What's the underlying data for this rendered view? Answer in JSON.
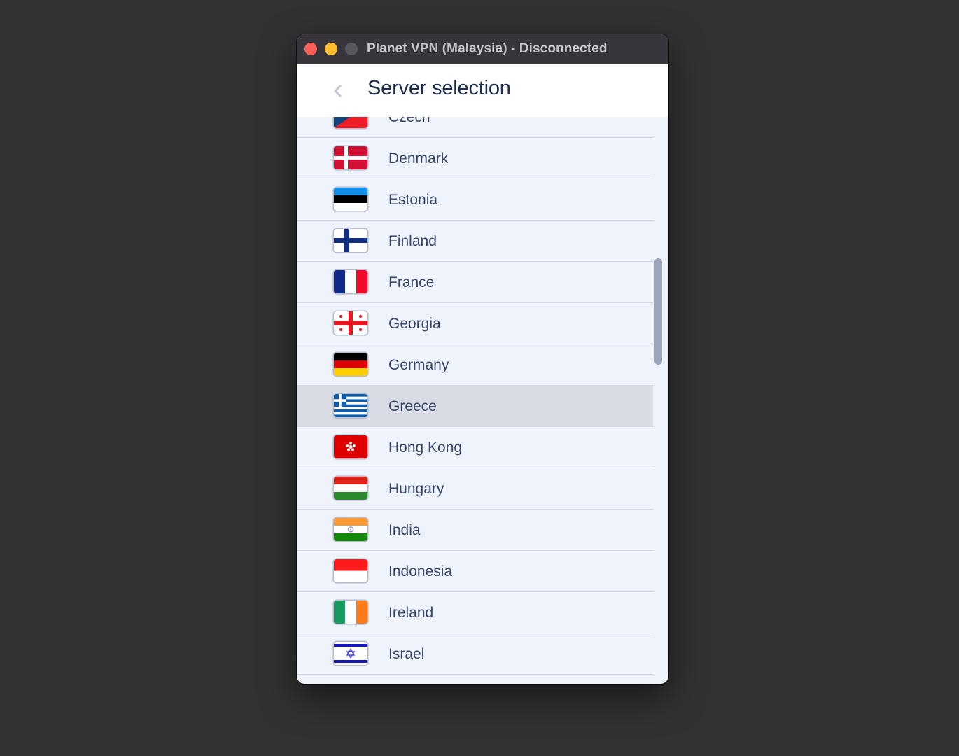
{
  "window": {
    "title": "Planet VPN (Malaysia) - Disconnected"
  },
  "header": {
    "back_icon": "chevron-left-icon",
    "title": "Server selection"
  },
  "servers": [
    {
      "country": "Czech",
      "flag": "cz"
    },
    {
      "country": "Denmark",
      "flag": "dk"
    },
    {
      "country": "Estonia",
      "flag": "ee"
    },
    {
      "country": "Finland",
      "flag": "fi"
    },
    {
      "country": "France",
      "flag": "fr"
    },
    {
      "country": "Georgia",
      "flag": "ge"
    },
    {
      "country": "Germany",
      "flag": "de"
    },
    {
      "country": "Greece",
      "flag": "gr",
      "selected": true
    },
    {
      "country": "Hong Kong",
      "flag": "hk"
    },
    {
      "country": "Hungary",
      "flag": "hu"
    },
    {
      "country": "India",
      "flag": "in"
    },
    {
      "country": "Indonesia",
      "flag": "id"
    },
    {
      "country": "Ireland",
      "flag": "ie"
    },
    {
      "country": "Israel",
      "flag": "il"
    }
  ],
  "colors": {
    "title_text": "#1d2f4f",
    "country_text": "#35476a",
    "list_bg": "#eff3fb",
    "selected_bg": "#d9dce4",
    "scrollbar": "#9ba6bc"
  }
}
